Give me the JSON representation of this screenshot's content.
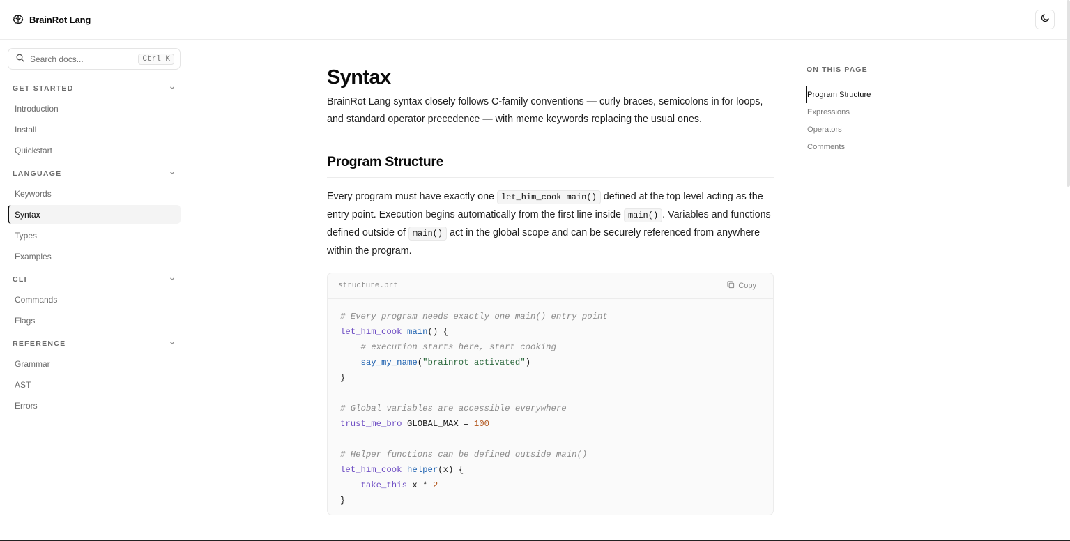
{
  "brand": {
    "name": "BrainRot Lang"
  },
  "search": {
    "placeholder": "Search docs...",
    "shortcut": "Ctrl K"
  },
  "sidebar": {
    "groups": [
      {
        "title": "GET STARTED",
        "items": [
          {
            "label": "Introduction"
          },
          {
            "label": "Install"
          },
          {
            "label": "Quickstart"
          }
        ]
      },
      {
        "title": "LANGUAGE",
        "items": [
          {
            "label": "Keywords"
          },
          {
            "label": "Syntax",
            "active": true
          },
          {
            "label": "Types"
          },
          {
            "label": "Examples"
          }
        ]
      },
      {
        "title": "CLI",
        "items": [
          {
            "label": "Commands"
          },
          {
            "label": "Flags"
          }
        ]
      },
      {
        "title": "REFERENCE",
        "items": [
          {
            "label": "Grammar"
          },
          {
            "label": "AST"
          },
          {
            "label": "Errors"
          }
        ]
      }
    ]
  },
  "header": {
    "theme_icon": "moon-icon"
  },
  "main": {
    "title": "Syntax",
    "lead": "BrainRot Lang syntax closely follows C-family conventions — curly braces, semicolons in for loops, and standard operator precedence — with meme keywords replacing the usual ones.",
    "section_title": "Program Structure",
    "para": {
      "p1": "Every program must have exactly one ",
      "c1": "let_him_cook main()",
      "p2": " defined at the top level acting as the entry point. Execution begins automatically from the first line inside ",
      "c2": "main()",
      "p3": ". Variables and functions defined outside of ",
      "c3": "main()",
      "p4": " act in the global scope and can be securely referenced from anywhere within the program."
    },
    "code": {
      "filename": "structure.brt",
      "copy_label": "Copy",
      "lines": [
        [
          {
            "t": "com",
            "v": "# Every program needs exactly one main() entry point"
          }
        ],
        [
          {
            "t": "kw",
            "v": "let_him_cook"
          },
          {
            "t": "",
            "v": " "
          },
          {
            "t": "fn",
            "v": "main"
          },
          {
            "t": "",
            "v": "() {"
          }
        ],
        [
          {
            "t": "",
            "v": "    "
          },
          {
            "t": "com",
            "v": "# execution starts here, start cooking"
          }
        ],
        [
          {
            "t": "",
            "v": "    "
          },
          {
            "t": "fn",
            "v": "say_my_name"
          },
          {
            "t": "",
            "v": "("
          },
          {
            "t": "str",
            "v": "\"brainrot activated\""
          },
          {
            "t": "",
            "v": ")"
          }
        ],
        [
          {
            "t": "",
            "v": "}"
          }
        ],
        [
          {
            "t": "",
            "v": ""
          }
        ],
        [
          {
            "t": "com",
            "v": "# Global variables are accessible everywhere"
          }
        ],
        [
          {
            "t": "kw",
            "v": "trust_me_bro"
          },
          {
            "t": "",
            "v": " GLOBAL_MAX = "
          },
          {
            "t": "num",
            "v": "100"
          }
        ],
        [
          {
            "t": "",
            "v": ""
          }
        ],
        [
          {
            "t": "com",
            "v": "# Helper functions can be defined outside main()"
          }
        ],
        [
          {
            "t": "kw",
            "v": "let_him_cook"
          },
          {
            "t": "",
            "v": " "
          },
          {
            "t": "fn",
            "v": "helper"
          },
          {
            "t": "",
            "v": "(x) {"
          }
        ],
        [
          {
            "t": "",
            "v": "    "
          },
          {
            "t": "kw",
            "v": "take_this"
          },
          {
            "t": "",
            "v": " x * "
          },
          {
            "t": "num",
            "v": "2"
          }
        ],
        [
          {
            "t": "",
            "v": "}"
          }
        ]
      ]
    }
  },
  "toc": {
    "title": "ON THIS PAGE",
    "items": [
      {
        "label": "Program Structure",
        "active": true
      },
      {
        "label": "Expressions"
      },
      {
        "label": "Operators"
      },
      {
        "label": "Comments"
      }
    ]
  }
}
